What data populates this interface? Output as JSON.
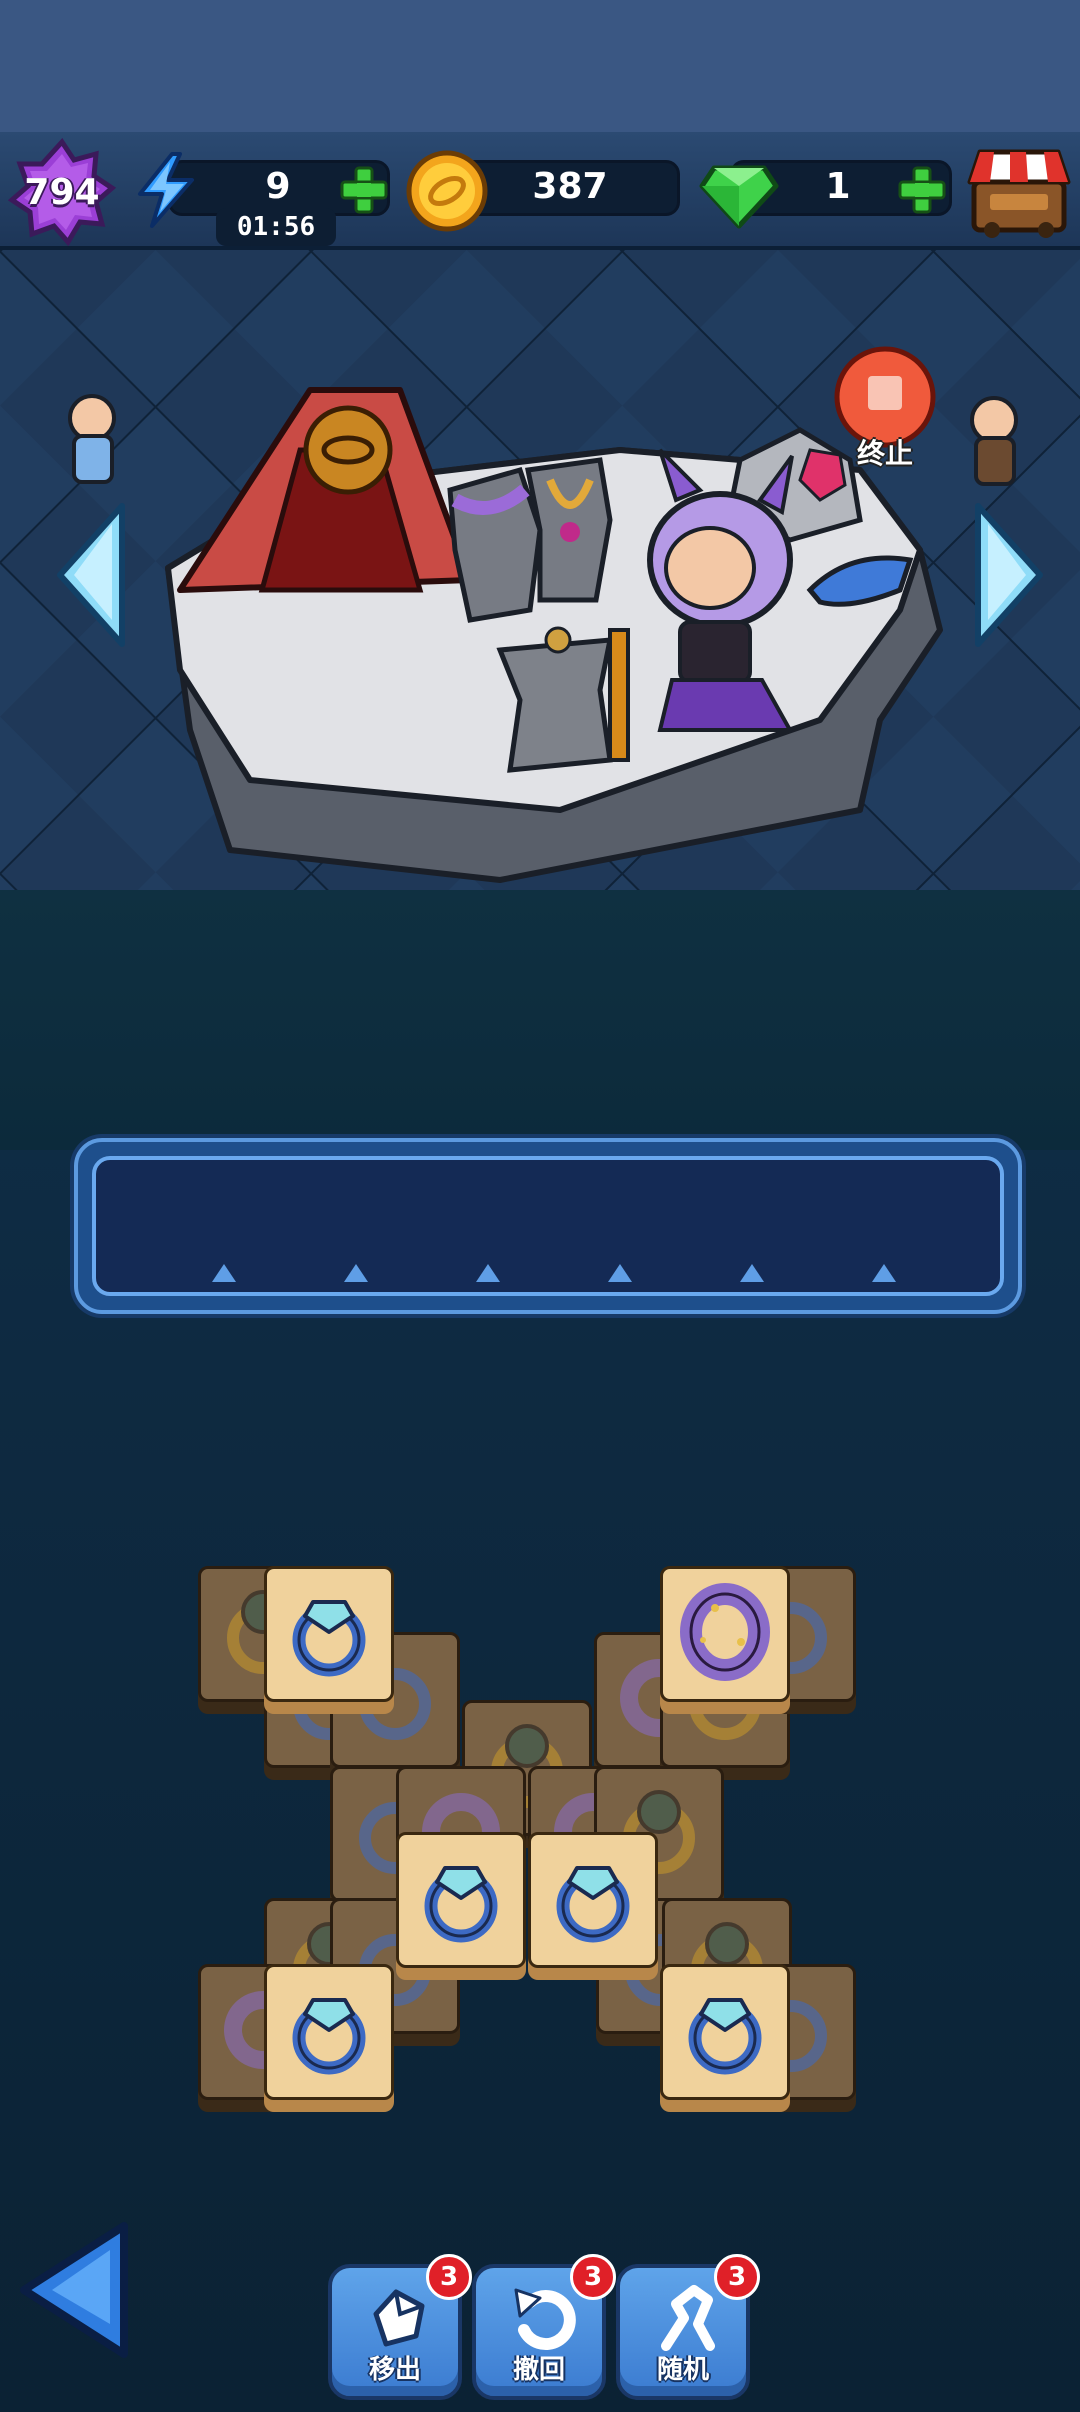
{
  "header": {
    "player_level": "794",
    "energy": {
      "value": "9",
      "timer": "01:56"
    },
    "coins": {
      "value": "387"
    },
    "gems": {
      "value": "1"
    }
  },
  "scene": {
    "stop_label": "终止"
  },
  "tray": {
    "slots": 6
  },
  "board": {
    "visible_top_tiles": [
      "blue-crystal-ring",
      "purple-stone-ring",
      "blue-crystal-ring",
      "blue-crystal-ring",
      "blue-crystal-ring",
      "blue-crystal-ring"
    ]
  },
  "toolbar": {
    "remove": {
      "label": "移出",
      "count": "3"
    },
    "undo": {
      "label": "撤回",
      "count": "3"
    },
    "shuffle": {
      "label": "随机",
      "count": "3"
    }
  },
  "colors": {
    "accent_blue": "#5fa4ea",
    "badge_red": "#e02028",
    "plus_green": "#3fcf3f",
    "tile_face": "#f0d29c"
  },
  "icons": [
    "level-star-icon",
    "lightning-icon",
    "coin-icon",
    "gem-icon",
    "shop-icon",
    "stop-icon",
    "back-arrow-icon",
    "remove-tool-icon",
    "undo-tool-icon",
    "shuffle-tool-icon"
  ]
}
